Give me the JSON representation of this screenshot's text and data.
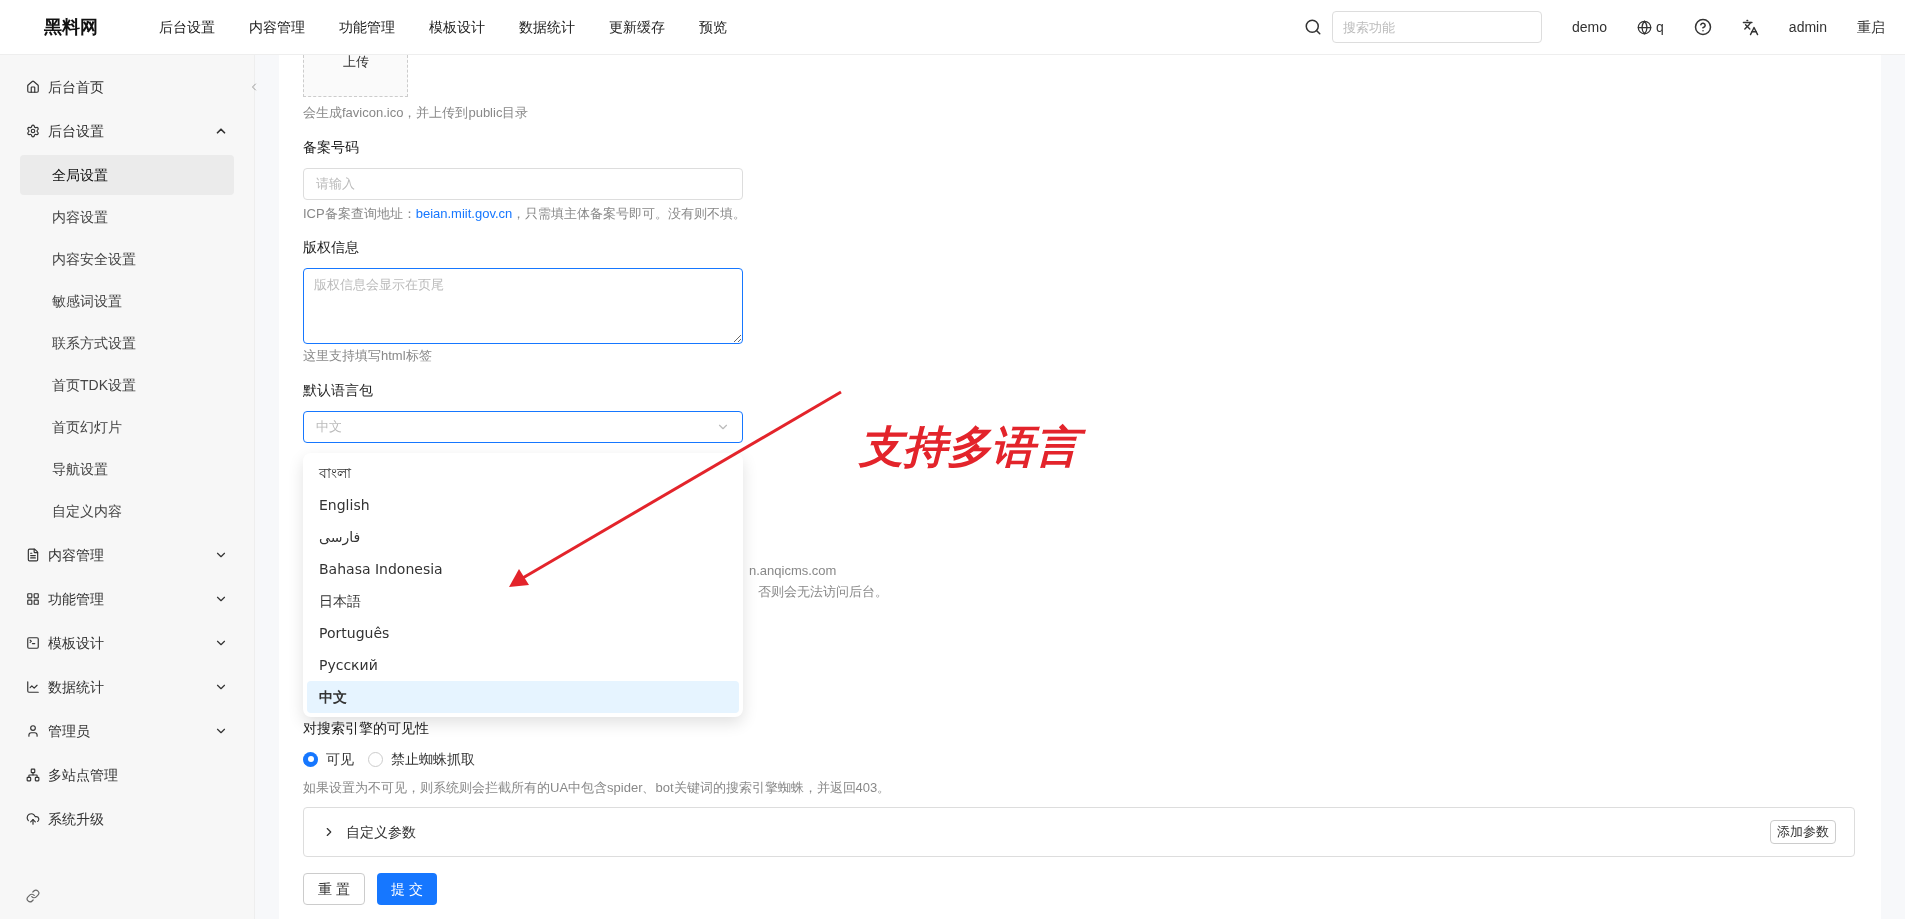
{
  "header": {
    "logo": "黑料网",
    "nav": [
      "后台设置",
      "内容管理",
      "功能管理",
      "模板设计",
      "数据统计",
      "更新缓存",
      "预览"
    ],
    "search": {
      "placeholder": "搜索功能"
    },
    "site": "demo",
    "language": "q",
    "user": "admin",
    "restart": "重启"
  },
  "sidebar": {
    "items": [
      {
        "kind": "link",
        "label": "后台首页"
      },
      {
        "kind": "group",
        "label": "后台设置",
        "expanded": true,
        "children": [
          {
            "label": "全局设置",
            "selected": true
          },
          {
            "label": "内容设置",
            "selected": false
          },
          {
            "label": "内容安全设置",
            "selected": false
          },
          {
            "label": "敏感词设置",
            "selected": false
          },
          {
            "label": "联系方式设置",
            "selected": false
          },
          {
            "label": "首页TDK设置",
            "selected": false
          },
          {
            "label": "首页幻灯片",
            "selected": false
          },
          {
            "label": "导航设置",
            "selected": false
          },
          {
            "label": "自定义内容",
            "selected": false
          }
        ]
      },
      {
        "kind": "group",
        "label": "内容管理",
        "expanded": false
      },
      {
        "kind": "group",
        "label": "功能管理",
        "expanded": false
      },
      {
        "kind": "group",
        "label": "模板设计",
        "expanded": false
      },
      {
        "kind": "group",
        "label": "数据统计",
        "expanded": false
      },
      {
        "kind": "group",
        "label": "管理员",
        "expanded": false
      },
      {
        "kind": "link",
        "label": "多站点管理"
      },
      {
        "kind": "link",
        "label": "系统升级"
      }
    ]
  },
  "form": {
    "upload": {
      "label": "上传",
      "hint": "会生成favicon.ico，并上传到public目录"
    },
    "icp": {
      "label": "备案号码",
      "placeholder": "请输入",
      "hint_before": "ICP备案查询地址：",
      "hint_link": "beian.miit.gov.cn",
      "hint_after": "，只需填主体备案号即可。没有则不填。"
    },
    "copyright": {
      "label": "版权信息",
      "placeholder": "版权信息会显示在页尾",
      "hint": "这里支持填写html标签"
    },
    "language": {
      "label": "默认语言包",
      "value": "中文",
      "open": true,
      "options": [
        {
          "label": "বাংলা",
          "selected": false
        },
        {
          "label": "English",
          "selected": false
        },
        {
          "label": "فارسی",
          "selected": false
        },
        {
          "label": "Bahasa Indonesia",
          "selected": false
        },
        {
          "label": "日本語",
          "selected": false
        },
        {
          "label": "Português",
          "selected": false
        },
        {
          "label": "Русский",
          "selected": false
        },
        {
          "label": "中文",
          "selected": true
        }
      ]
    },
    "covered_hints": [
      "n.anqicms.com",
      "否则会无法访问后台。"
    ],
    "visibility": {
      "label": "对搜索引擎的可见性",
      "options": [
        {
          "label": "可见",
          "selected": true
        },
        {
          "label": "禁止蜘蛛抓取",
          "selected": false
        }
      ],
      "hint": "如果设置为不可见，则系统则会拦截所有的UA中包含spider、bot关键词的搜索引擎蜘蛛，并返回403。"
    },
    "custom_params": {
      "label": "自定义参数",
      "expanded": false,
      "add": "添加参数"
    },
    "buttons": {
      "reset": "重 置",
      "submit": "提 交"
    }
  },
  "annotation": "支持多语言"
}
